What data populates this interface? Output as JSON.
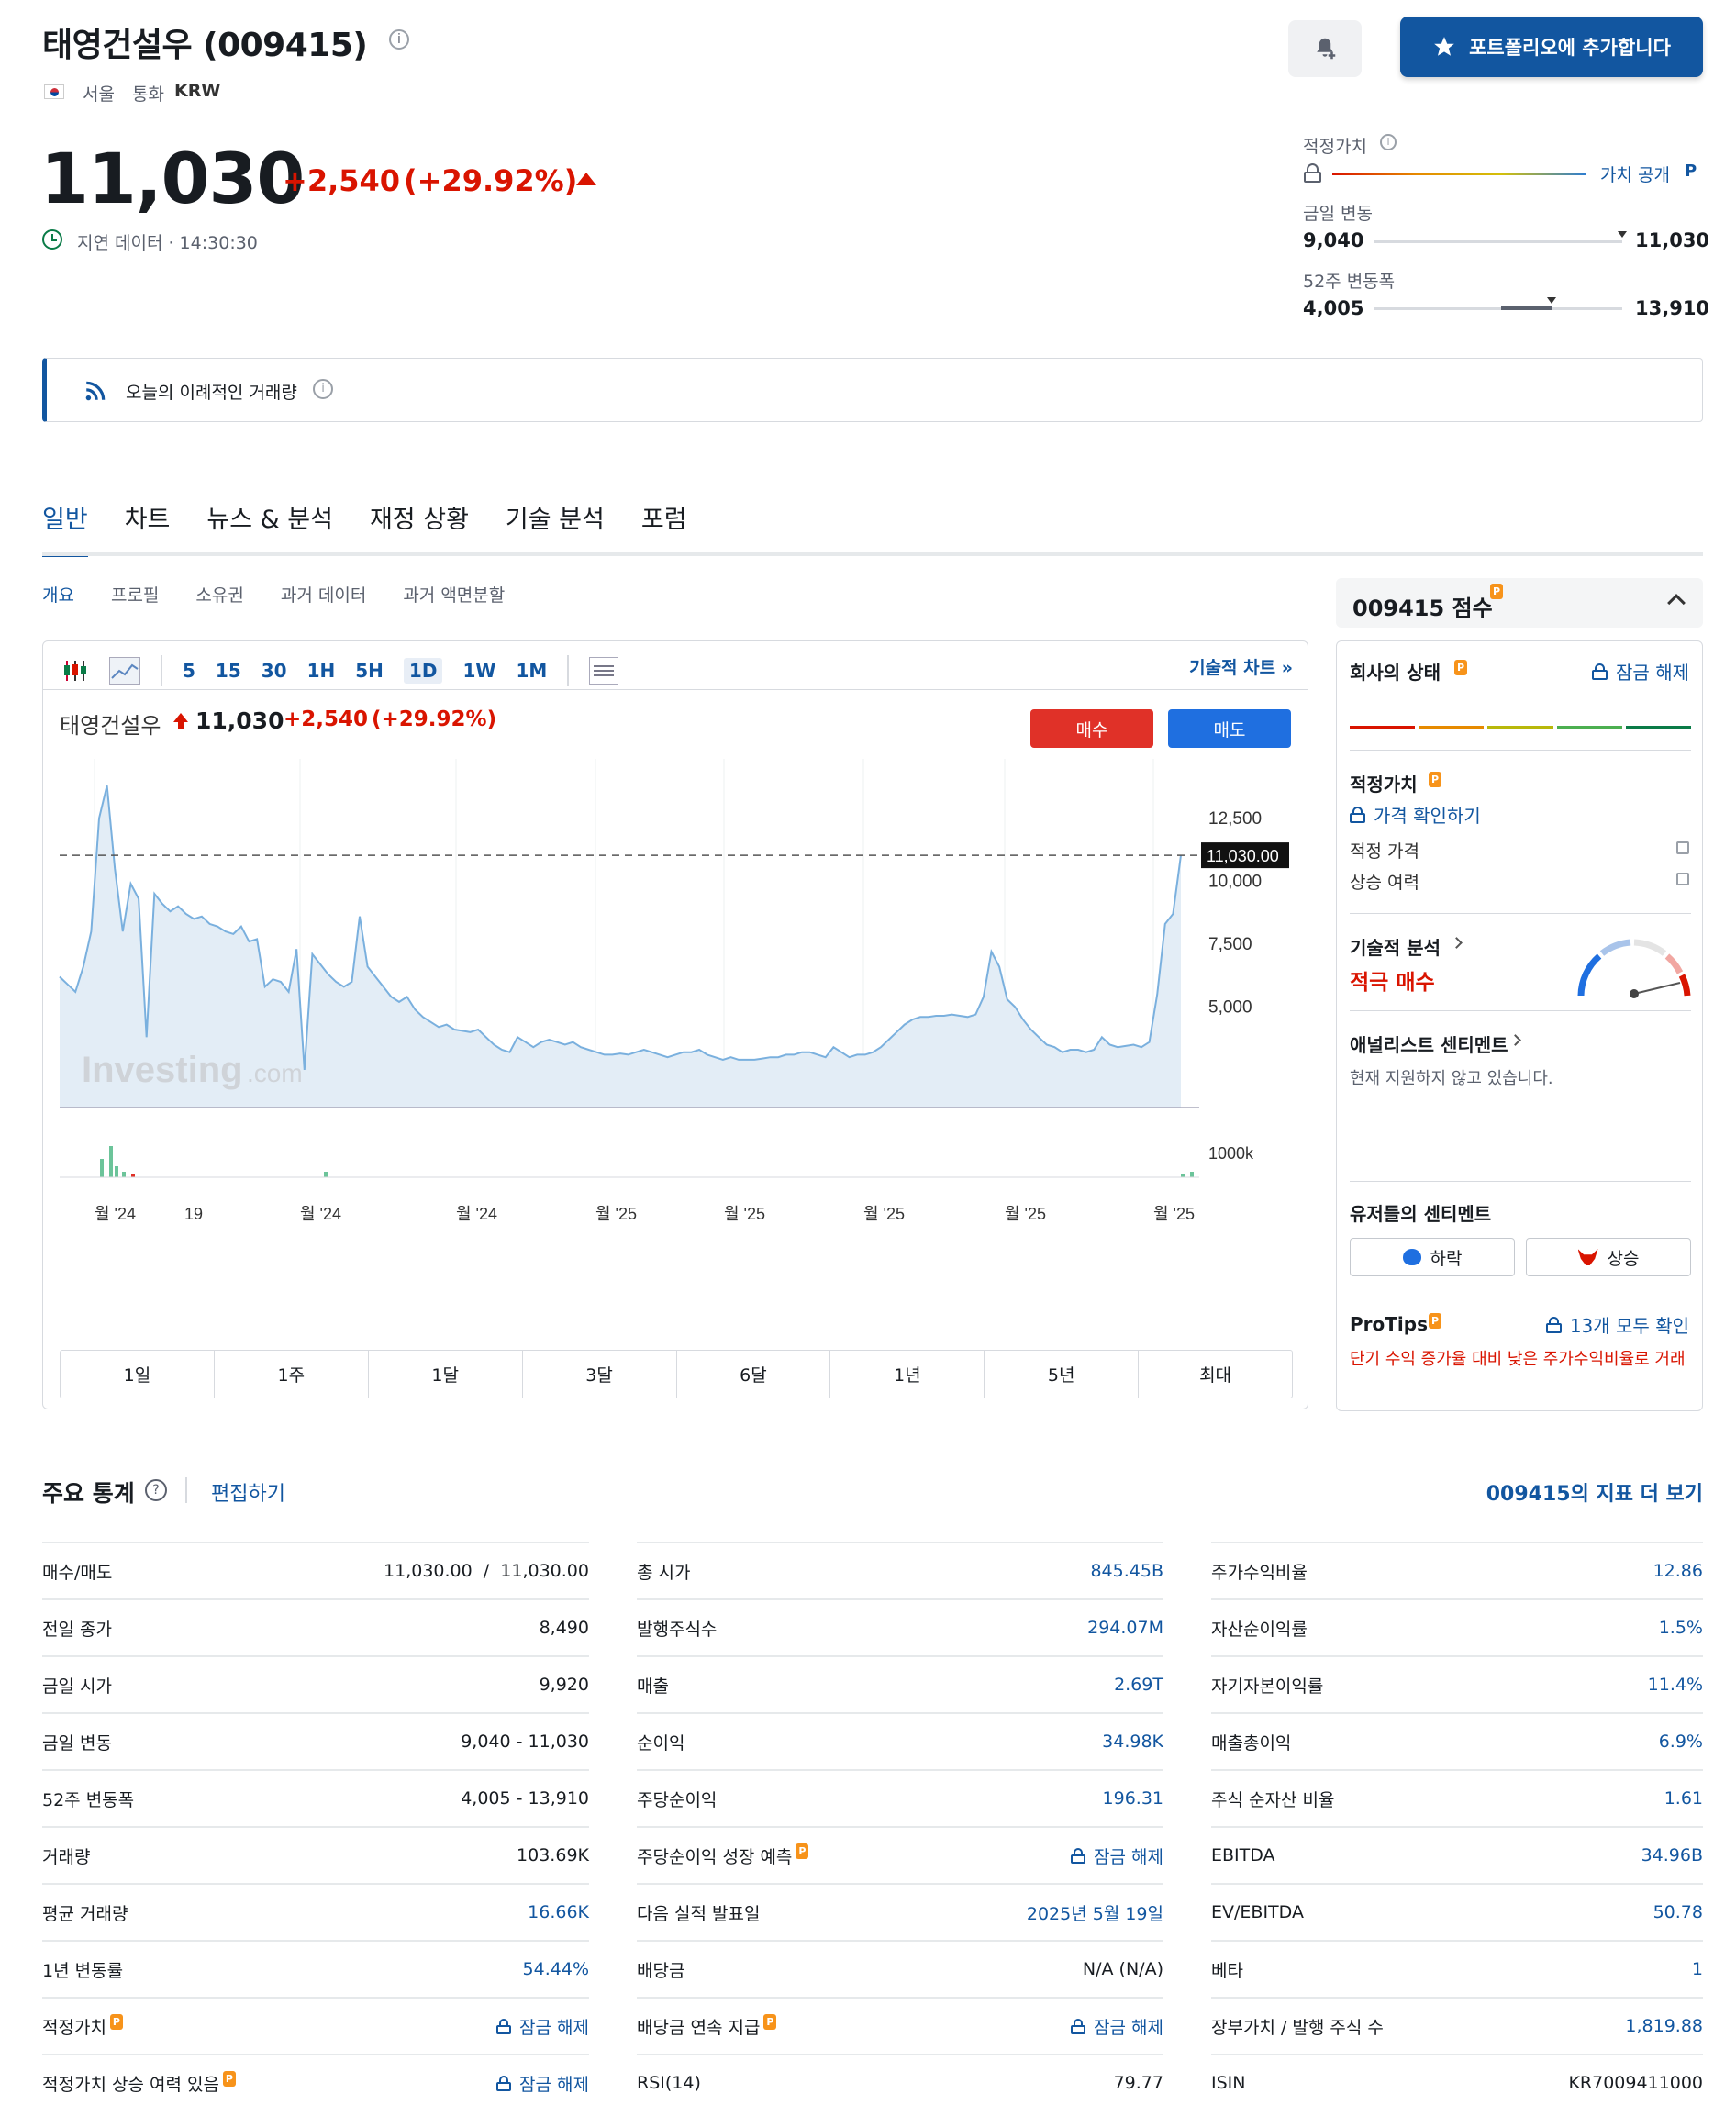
{
  "header": {
    "name": "태영건설우 (009415)",
    "flag": "KR-flag",
    "exchange": "서울",
    "currency_label": "통화",
    "currency": "KRW",
    "alert_icon": "bell-plus-icon",
    "portfolio_button": "포트폴리오에 추가합니다"
  },
  "quote": {
    "price": "11,030",
    "change": "+2,540",
    "change_pct": "(+29.92%)",
    "delay_text": "지연 데이터 · 14:30:30"
  },
  "ranges": {
    "fair_value_label": "적정가치",
    "fair_value_link": "가치 공개",
    "day_label": "금일 변동",
    "day_low": "9,040",
    "day_high": "11,030",
    "week52_label": "52주 변동폭",
    "week52_low": "4,005",
    "week52_high": "13,910"
  },
  "notice": {
    "text": "오늘의 이례적인 거래량"
  },
  "tabs": [
    "일반",
    "차트",
    "뉴스 & 분석",
    "재정 상황",
    "기술 분석",
    "포럼"
  ],
  "subtabs": [
    "개요",
    "프로필",
    "소유권",
    "과거 데이터",
    "과거 액면분할"
  ],
  "chart": {
    "intervals": [
      "5",
      "15",
      "30",
      "1H",
      "5H",
      "1D",
      "1W",
      "1M"
    ],
    "selected_interval": "1D",
    "tech_chart_link": "기술적 차트 »",
    "legend_name": "태영건설우",
    "legend_price": "11,030",
    "legend_change": "+2,540",
    "legend_pct": "(+29.92%)",
    "buy_label": "매수",
    "sell_label": "매도",
    "current_label": "11,030.00",
    "watermark": "Investing",
    "watermark_suffix": ".com",
    "y_ticks": [
      "12,500",
      "10,000",
      "7,500",
      "5,000"
    ],
    "vol_tick": "1000k",
    "x_ticks": [
      "월 '24",
      "19",
      "월 '24",
      "월 '24",
      "월 '25",
      "월 '25",
      "월 '25",
      "월 '25",
      "월 '25"
    ],
    "range_buttons": [
      "1일",
      "1주",
      "1달",
      "3달",
      "6달",
      "1년",
      "5년",
      "최대"
    ]
  },
  "chart_data": {
    "type": "area",
    "title": "",
    "xlabel": "",
    "ylabel": "",
    "ylim": [
      1000,
      14500
    ],
    "values": [
      6200,
      5900,
      5600,
      6600,
      8000,
      12500,
      13800,
      10500,
      8000,
      9900,
      9300,
      3800,
      9500,
      9100,
      8800,
      9000,
      8700,
      8500,
      8600,
      8300,
      8200,
      8000,
      7900,
      8200,
      7600,
      7700,
      5800,
      6100,
      6000,
      5600,
      7300,
      2500,
      7100,
      6700,
      6300,
      6000,
      5800,
      6000,
      8600,
      6600,
      6200,
      5800,
      5400,
      5200,
      5400,
      4900,
      4600,
      4400,
      4200,
      4300,
      4100,
      4050,
      4000,
      4100,
      3800,
      3500,
      3300,
      3200,
      3800,
      3600,
      3400,
      3600,
      3700,
      3600,
      3500,
      3600,
      3400,
      3300,
      3200,
      3100,
      3100,
      3150,
      3100,
      3200,
      3300,
      3200,
      3100,
      3000,
      3100,
      3200,
      3200,
      3300,
      3100,
      3000,
      2900,
      3000,
      2900,
      2900,
      2900,
      2950,
      3000,
      3000,
      3100,
      3100,
      3200,
      3200,
      3100,
      3000,
      3400,
      3200,
      3000,
      3100,
      3100,
      3200,
      3400,
      3700,
      4000,
      4300,
      4500,
      4600,
      4600,
      4650,
      4650,
      4700,
      4650,
      4600,
      4700,
      5400,
      7200,
      6600,
      5300,
      5000,
      4500,
      4100,
      3800,
      3500,
      3400,
      3200,
      3300,
      3300,
      3200,
      3300,
      3800,
      3500,
      3400,
      3450,
      3500,
      3400,
      3600,
      5500,
      8300,
      8700,
      11030
    ],
    "current": 11030
  },
  "sidebar": {
    "score_title": "009415 점수",
    "health_label": "회사의 상태",
    "health_unlock": "잠금 해제",
    "health_bars": [
      "#d91400",
      "#e68a00",
      "#b8b80a",
      "#4caf50",
      "#0a7b47"
    ],
    "fair_value_label": "적정가치",
    "price_check": "가격 확인하기",
    "fair_price": "적정 가격",
    "upside": "상승 여력",
    "tech_label": "기술적 분석",
    "tech_value": "적극 매수",
    "analyst_label": "애널리스트 센티멘트",
    "analyst_note": "현재 지원하지 않고 있습니다.",
    "user_sent_label": "유저들의 센티멘트",
    "bear_label": "하락",
    "bull_label": "상승",
    "protips_label": "ProTips",
    "protips_link": "13개 모두 확인",
    "protips_text": "단기 수익 증가율 대비 낮은 주가수익비율로 거래"
  },
  "stats": {
    "title": "주요 통계",
    "edit": "편집하기",
    "more": "009415의 지표 더 보기",
    "col1": [
      {
        "label": "매수/매도",
        "value": "11,030.00  /  11,030.00",
        "link": false,
        "pro": false
      },
      {
        "label": "전일 종가",
        "value": "8,490",
        "link": false,
        "pro": false
      },
      {
        "label": "금일 시가",
        "value": "9,920",
        "link": false,
        "pro": false
      },
      {
        "label": "금일 변동",
        "value": "9,040 - 11,030",
        "link": false,
        "pro": false
      },
      {
        "label": "52주 변동폭",
        "value": "4,005 - 13,910",
        "link": false,
        "pro": false
      },
      {
        "label": "거래량",
        "value": "103.69K",
        "link": false,
        "pro": false
      },
      {
        "label": "평균 거래량",
        "value": "16.66K",
        "link": true,
        "pro": false
      },
      {
        "label": "1년 변동률",
        "value": "54.44%",
        "link": true,
        "pro": false
      },
      {
        "label": "적정가치",
        "value": "잠금 해제",
        "link": true,
        "pro": true,
        "lock": true
      },
      {
        "label": "적정가치 상승 여력 있음",
        "value": "잠금 해제",
        "link": true,
        "pro": true,
        "lock": true
      }
    ],
    "col2": [
      {
        "label": "총 시가",
        "value": "845.45B",
        "link": true,
        "pro": false
      },
      {
        "label": "발행주식수",
        "value": "294.07M",
        "link": true,
        "pro": false
      },
      {
        "label": "매출",
        "value": "2.69T",
        "link": true,
        "pro": false
      },
      {
        "label": "순이익",
        "value": "34.98K",
        "link": true,
        "pro": false
      },
      {
        "label": "주당순이익",
        "value": "196.31",
        "link": true,
        "pro": false
      },
      {
        "label": "주당순이익 성장 예측",
        "value": "잠금 해제",
        "link": true,
        "pro": true,
        "lock": true
      },
      {
        "label": "다음 실적 발표일",
        "value": "2025년 5월 19일",
        "link": true,
        "pro": false
      },
      {
        "label": "배당금",
        "value": "N/A (N/A)",
        "link": false,
        "pro": false
      },
      {
        "label": "배당금 연속 지급",
        "value": "잠금 해제",
        "link": true,
        "pro": true,
        "lock": true
      },
      {
        "label": "RSI(14)",
        "value": "79.77",
        "link": false,
        "pro": false
      }
    ],
    "col3": [
      {
        "label": "주가수익비율",
        "value": "12.86",
        "link": true,
        "pro": false
      },
      {
        "label": "자산순이익률",
        "value": "1.5%",
        "link": true,
        "pro": false
      },
      {
        "label": "자기자본이익률",
        "value": "11.4%",
        "link": true,
        "pro": false
      },
      {
        "label": "매출총이익",
        "value": "6.9%",
        "link": true,
        "pro": false
      },
      {
        "label": "주식 순자산 비율",
        "value": "1.61",
        "link": true,
        "pro": false
      },
      {
        "label": "EBITDA",
        "value": "34.96B",
        "link": true,
        "pro": false
      },
      {
        "label": "EV/EBITDA",
        "value": "50.78",
        "link": true,
        "pro": false
      },
      {
        "label": "베타",
        "value": "1",
        "link": true,
        "pro": false
      },
      {
        "label": "장부가치 / 발행 주식 수",
        "value": "1,819.88",
        "link": true,
        "pro": false
      },
      {
        "label": "ISIN",
        "value": "KR7009411000",
        "link": false,
        "pro": false
      }
    ]
  }
}
